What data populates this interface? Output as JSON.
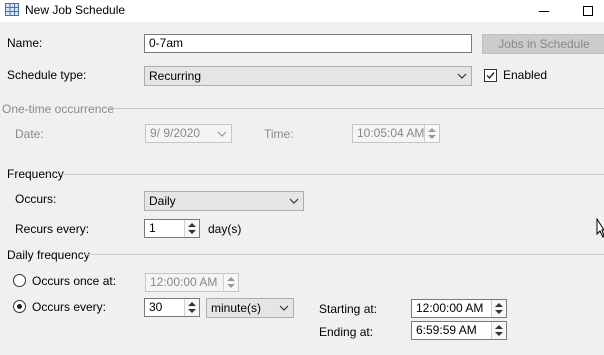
{
  "window": {
    "title": "New Job Schedule"
  },
  "form": {
    "name_label": "Name:",
    "name_value": "0-7am",
    "jobs_button": "Jobs in Schedule",
    "schedule_type_label": "Schedule type:",
    "schedule_type_value": "Recurring",
    "enabled_label": "Enabled",
    "enabled_checked": true
  },
  "one_time": {
    "header": "One-time occurrence",
    "date_label": "Date:",
    "date_value": "9/  9/2020",
    "time_label": "Time:",
    "time_value": "10:05:04 AM"
  },
  "frequency": {
    "header": "Frequency",
    "occurs_label": "Occurs:",
    "occurs_value": "Daily",
    "recurs_label": "Recurs every:",
    "recurs_value": "1",
    "recurs_unit": "day(s)"
  },
  "daily": {
    "header": "Daily frequency",
    "once_label": "Occurs once at:",
    "once_value": "12:00:00 AM",
    "every_label": "Occurs every:",
    "every_value": "30",
    "every_unit": "minute(s)",
    "starting_label": "Starting at:",
    "starting_value": "12:00:00 AM",
    "ending_label": "Ending at:",
    "ending_value": "6:59:59 AM",
    "selected_option": "Occurs every:"
  },
  "icons": [
    "grid-app-icon",
    "minimize-icon",
    "maximize-icon",
    "chevron-down-icon",
    "checkmark-icon",
    "spin-up-icon",
    "spin-down-icon",
    "mouse-cursor-icon"
  ]
}
